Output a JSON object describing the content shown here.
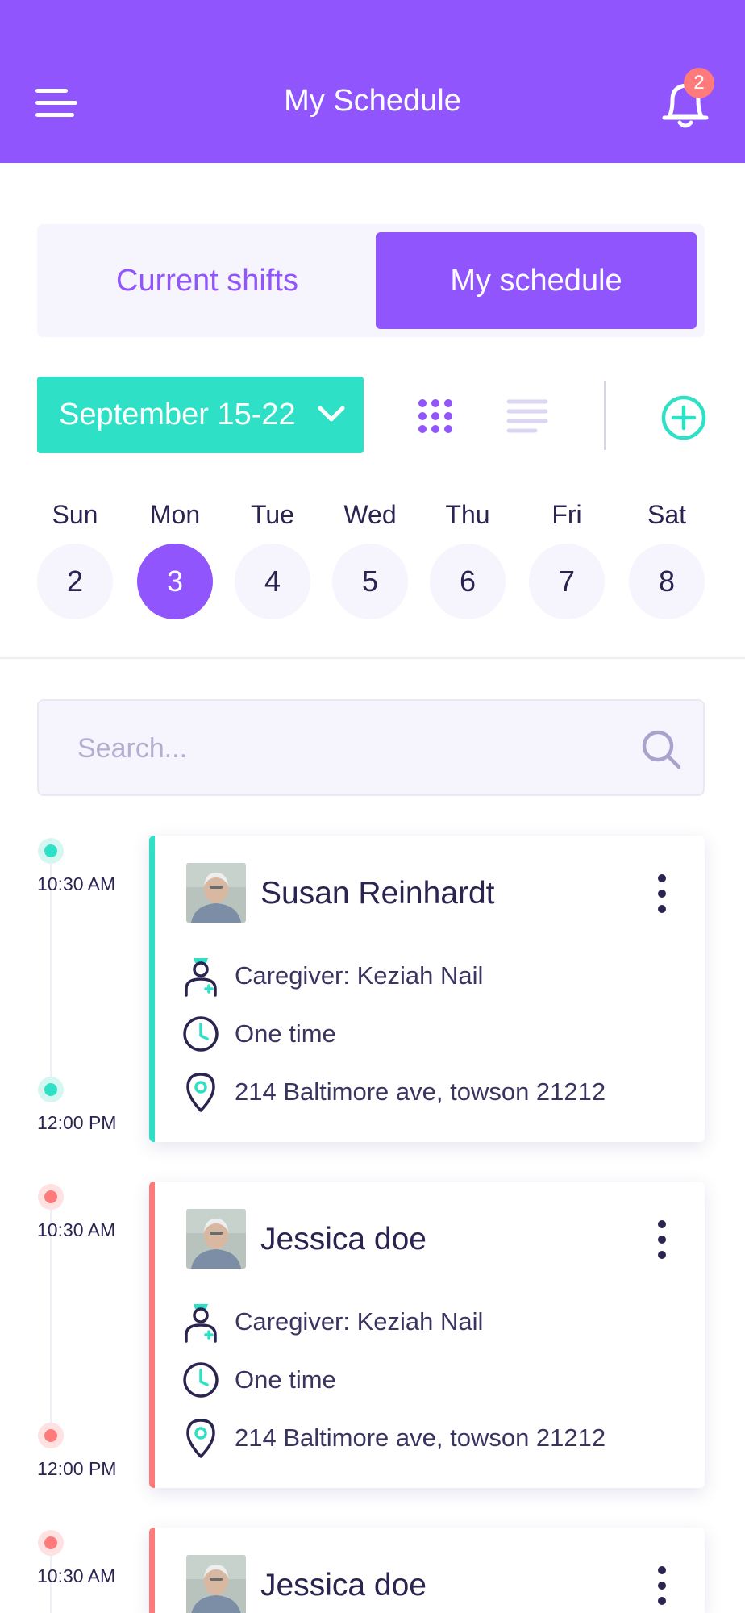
{
  "header": {
    "title": "My Schedule",
    "notification_count": "2"
  },
  "tabs": {
    "current_label": "Current shifts",
    "schedule_label": "My schedule"
  },
  "toolbar": {
    "week_label": "September 15-22"
  },
  "days": [
    {
      "name": "Sun",
      "date": "2"
    },
    {
      "name": "Mon",
      "date": "3"
    },
    {
      "name": "Tue",
      "date": "4"
    },
    {
      "name": "Wed",
      "date": "5"
    },
    {
      "name": "Thu",
      "date": "6"
    },
    {
      "name": "Fri",
      "date": "7"
    },
    {
      "name": "Sat",
      "date": "8"
    }
  ],
  "search": {
    "placeholder": "Search..."
  },
  "shifts": [
    {
      "name": "Susan Reinhardt",
      "caregiver": "Caregiver: Keziah Nail",
      "frequency": "One time",
      "address": "214 Baltimore ave, towson 21212",
      "start": "10:30 AM",
      "end": "12:00 PM",
      "accent": "#2ee0c5"
    },
    {
      "name": "Jessica doe",
      "caregiver": "Caregiver: Keziah Nail",
      "frequency": "One time",
      "address": "214 Baltimore ave, towson 21212",
      "start": "10:30 AM",
      "end": "12:00 PM",
      "accent": "#ff7a7a"
    },
    {
      "name": "Jessica doe",
      "start": "10:30 AM",
      "accent": "#ff7a7a"
    }
  ],
  "colors": {
    "primary": "#9155fd",
    "teal": "#2ee0c5",
    "coral": "#ff7a7a",
    "text": "#2a2450"
  },
  "icons": [
    "hamburger-menu-icon",
    "bell-icon",
    "chevron-down-icon",
    "grid-dots-icon",
    "list-lines-icon",
    "plus-circle-icon",
    "search-icon",
    "nurse-icon",
    "clock-icon",
    "location-pin-icon",
    "kebab-menu-icon"
  ]
}
